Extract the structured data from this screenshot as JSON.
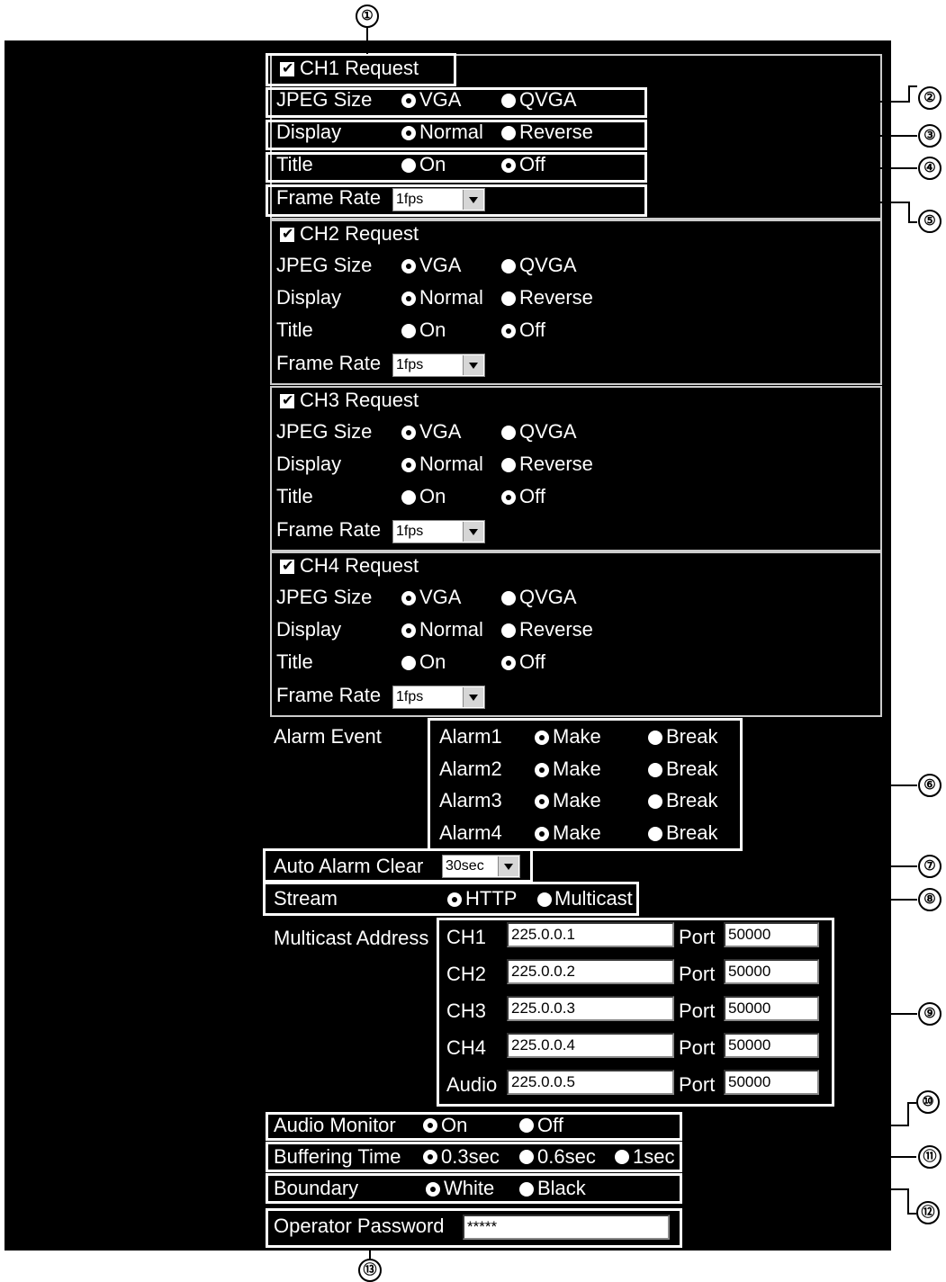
{
  "channels": [
    {
      "request_label": "CH1 Request",
      "jpeg_label": "JPEG Size",
      "vga": "VGA",
      "qvga": "QVGA",
      "display_label": "Display",
      "normal": "Normal",
      "reverse": "Reverse",
      "title_label": "Title",
      "on": "On",
      "off": "Off",
      "frame_rate_label": "Frame Rate",
      "frame_rate_value": "1fps"
    },
    {
      "request_label": "CH2 Request",
      "jpeg_label": "JPEG Size",
      "vga": "VGA",
      "qvga": "QVGA",
      "display_label": "Display",
      "normal": "Normal",
      "reverse": "Reverse",
      "title_label": "Title",
      "on": "On",
      "off": "Off",
      "frame_rate_label": "Frame Rate",
      "frame_rate_value": "1fps"
    },
    {
      "request_label": "CH3 Request",
      "jpeg_label": "JPEG Size",
      "vga": "VGA",
      "qvga": "QVGA",
      "display_label": "Display",
      "normal": "Normal",
      "reverse": "Reverse",
      "title_label": "Title",
      "on": "On",
      "off": "Off",
      "frame_rate_label": "Frame Rate",
      "frame_rate_value": "1fps"
    },
    {
      "request_label": "CH4 Request",
      "jpeg_label": "JPEG Size",
      "vga": "VGA",
      "qvga": "QVGA",
      "display_label": "Display",
      "normal": "Normal",
      "reverse": "Reverse",
      "title_label": "Title",
      "on": "On",
      "off": "Off",
      "frame_rate_label": "Frame Rate",
      "frame_rate_value": "1fps"
    }
  ],
  "alarm": {
    "label": "Alarm Event",
    "rows": [
      {
        "name": "Alarm1",
        "make": "Make",
        "break": "Break"
      },
      {
        "name": "Alarm2",
        "make": "Make",
        "break": "Break"
      },
      {
        "name": "Alarm3",
        "make": "Make",
        "break": "Break"
      },
      {
        "name": "Alarm4",
        "make": "Make",
        "break": "Break"
      }
    ]
  },
  "auto_alarm_clear": {
    "label": "Auto Alarm Clear",
    "value": "30sec"
  },
  "stream": {
    "label": "Stream",
    "http": "HTTP",
    "multicast": "Multicast"
  },
  "multicast": {
    "label": "Multicast Address",
    "port_label": "Port",
    "rows": [
      {
        "ch": "CH1",
        "address": "225.0.0.1",
        "port": "50000"
      },
      {
        "ch": "CH2",
        "address": "225.0.0.2",
        "port": "50000"
      },
      {
        "ch": "CH3",
        "address": "225.0.0.3",
        "port": "50000"
      },
      {
        "ch": "CH4",
        "address": "225.0.0.4",
        "port": "50000"
      },
      {
        "ch": "Audio",
        "address": "225.0.0.5",
        "port": "50000"
      }
    ]
  },
  "audio_monitor": {
    "label": "Audio Monitor",
    "on": "On",
    "off": "Off"
  },
  "buffering": {
    "label": "Buffering Time",
    "opt1": "0.3sec",
    "opt2": "0.6sec",
    "opt3": "1sec"
  },
  "boundary": {
    "label": "Boundary",
    "white": "White",
    "black": "Black"
  },
  "operator_password": {
    "label": "Operator Password",
    "value": "*****"
  },
  "callouts": [
    "①",
    "②",
    "③",
    "④",
    "⑤",
    "⑥",
    "⑦",
    "⑧",
    "⑨",
    "⑩",
    "⑪",
    "⑫",
    "⑬"
  ]
}
